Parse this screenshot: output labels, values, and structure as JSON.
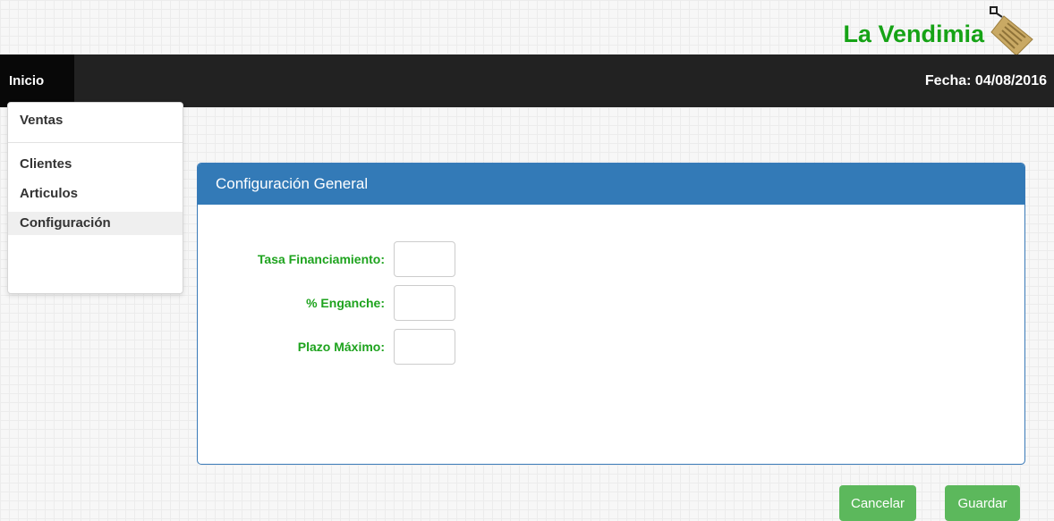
{
  "brand": {
    "name": "La Vendimia",
    "colors": {
      "brand_green": "#16a316",
      "tag_tan": "#c9a964"
    }
  },
  "navbar": {
    "home_label": "Inicio",
    "date_text": "Fecha: 04/08/2016",
    "colors": {
      "bar": "#222222",
      "active": "#080808"
    }
  },
  "menu": {
    "items": [
      {
        "label": "Ventas"
      },
      {
        "label": "Clientes"
      },
      {
        "label": "Articulos"
      },
      {
        "label": "Configuración",
        "active": true
      }
    ]
  },
  "panel": {
    "title": "Configuración General",
    "heading_color": "#337ab7",
    "fields": [
      {
        "label": "Tasa Financiamiento:",
        "value": "",
        "placeholder": ""
      },
      {
        "label": "% Enganche:",
        "value": "",
        "placeholder": ""
      },
      {
        "label": "Plazo Máximo:",
        "value": "",
        "placeholder": ""
      }
    ],
    "label_color": "#1ea31e"
  },
  "actions": {
    "cancel_label": "Cancelar",
    "save_label": "Guardar",
    "button_color": "#5cb85c"
  }
}
